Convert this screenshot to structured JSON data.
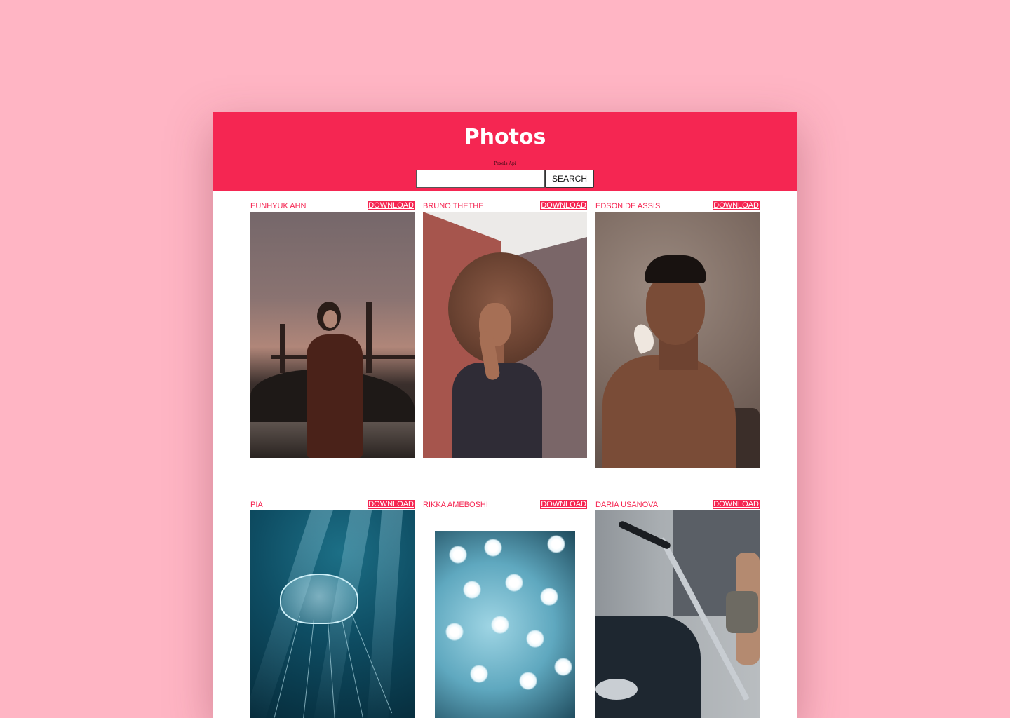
{
  "header": {
    "title": "Photos",
    "subtitle": "Pexels Api",
    "search_placeholder": "",
    "search_value": "",
    "search_button": "SEARCH"
  },
  "photos": [
    {
      "author": "EUNHYUK AHN",
      "download": "DOWNLOAD"
    },
    {
      "author": "BRUNO THETHE",
      "download": "DOWNLOAD"
    },
    {
      "author": "EDSON DE ASSIS",
      "download": "DOWNLOAD"
    },
    {
      "author": "PIA",
      "download": "DOWNLOAD"
    },
    {
      "author": "RIKKA AMEBOSHI",
      "download": "DOWNLOAD"
    },
    {
      "author": "DARIA USANOVA",
      "download": "DOWNLOAD"
    }
  ],
  "colors": {
    "accent": "#f52652",
    "page_background": "#ffb5c4",
    "card_background": "#ffffff"
  }
}
